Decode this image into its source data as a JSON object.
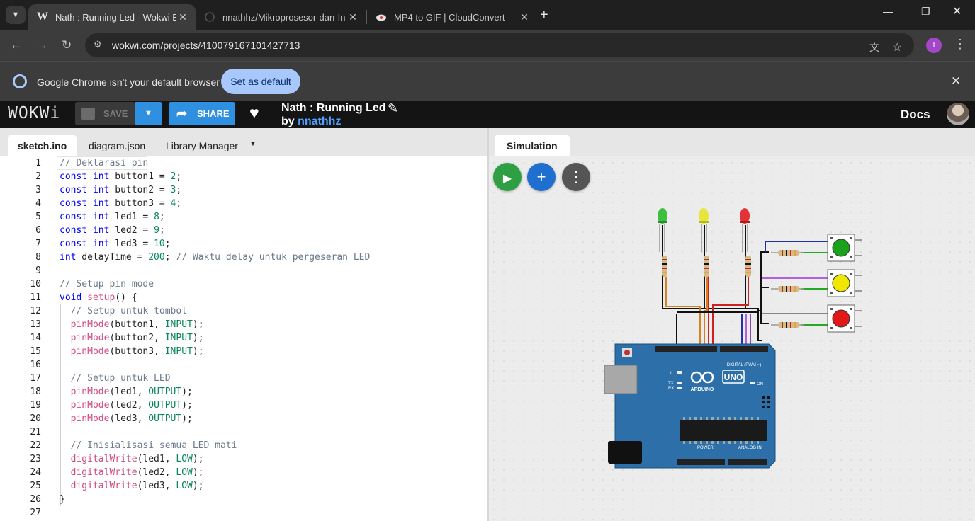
{
  "browser": {
    "tabs": [
      {
        "title": "Nath : Running Led - Wokwi ESP",
        "favicon": "W",
        "active": true
      },
      {
        "title": "nnathhz/Mikroprosesor-dan-Int",
        "favicon": "github-icon",
        "active": false
      },
      {
        "title": "MP4 to GIF | CloudConvert",
        "favicon": "cloud-icon",
        "active": false
      }
    ],
    "url": "wokwi.com/projects/410079167101427713",
    "profile_initial": "I",
    "infobar": {
      "message": "Google Chrome isn't your default browser",
      "button": "Set as default"
    }
  },
  "wokwi": {
    "logo": "WOKWi",
    "save_label": "SAVE",
    "share_label": "SHARE",
    "project_title": "Nath : Running Led",
    "by_label": "by",
    "author": "nnathhz",
    "docs_label": "Docs"
  },
  "editor": {
    "tabs": [
      "sketch.ino",
      "diagram.json",
      "Library Manager"
    ],
    "line_numbers": [
      "1",
      "2",
      "3",
      "4",
      "5",
      "6",
      "7",
      "8",
      "9",
      "10",
      "11",
      "12",
      "13",
      "14",
      "15",
      "16",
      "17",
      "18",
      "19",
      "20",
      "21",
      "22",
      "23",
      "24",
      "25",
      "26",
      "27"
    ],
    "code": [
      "// Deklarasi pin",
      "const int button1 = 2;",
      "const int button2 = 3;",
      "const int button3 = 4;",
      "const int led1 = 8;",
      "const int led2 = 9;",
      "const int led3 = 10;",
      "int delayTime = 200; // Waktu delay untuk pergeseran LED",
      "",
      "// Setup pin mode",
      "void setup() {",
      "  // Setup untuk tombol",
      "  pinMode(button1, INPUT);",
      "  pinMode(button2, INPUT);",
      "  pinMode(button3, INPUT);",
      "",
      "  // Setup untuk LED",
      "  pinMode(led1, OUTPUT);",
      "  pinMode(led2, OUTPUT);",
      "  pinMode(led3, OUTPUT);",
      "",
      "  // Inisialisasi semua LED mati",
      "  digitalWrite(led1, LOW);",
      "  digitalWrite(led2, LOW);",
      "  digitalWrite(led3, LOW);",
      "}",
      ""
    ]
  },
  "simulation": {
    "tab_label": "Simulation",
    "board": {
      "brand": "ARDUINO",
      "model": "UNO",
      "digital_label": "DIGITAL (PWM ~)",
      "power_label": "POWER",
      "analog_label": "ANALOG IN",
      "on_label": "ON",
      "tx_label": "TX",
      "rx_label": "RX",
      "l_label": "L"
    },
    "leds": [
      {
        "color_name": "green",
        "color": "#3fbf3f"
      },
      {
        "color_name": "yellow",
        "color": "#e6e63c"
      },
      {
        "color_name": "red",
        "color": "#e23434"
      }
    ],
    "buttons": [
      {
        "color_name": "green",
        "color": "#1aa31a"
      },
      {
        "color_name": "yellow",
        "color": "#f0e600"
      },
      {
        "color_name": "red",
        "color": "#e01818"
      }
    ]
  }
}
